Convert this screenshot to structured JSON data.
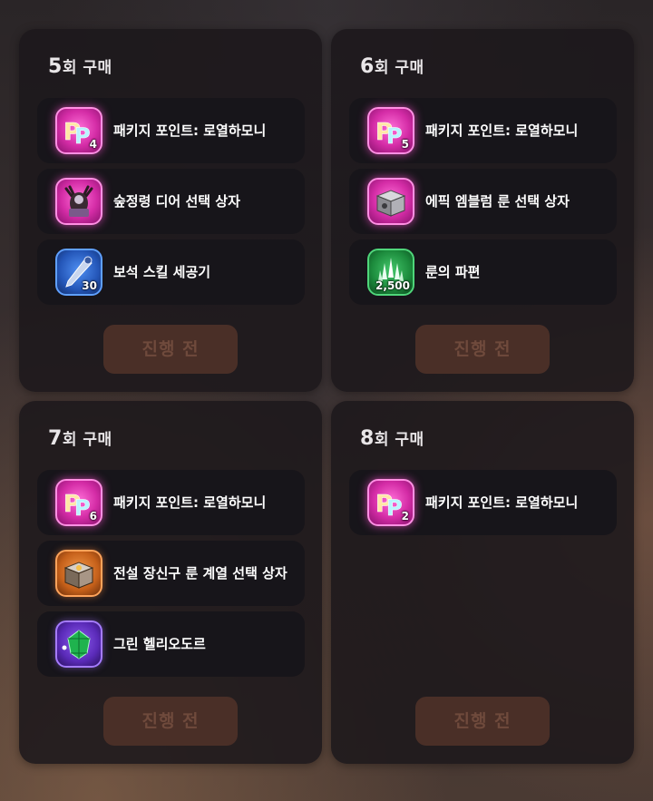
{
  "panels": [
    {
      "title_num": "5",
      "title_rest": "회 구매",
      "items": [
        {
          "label": "패키지 포인트: 로열하모니",
          "icon": "package-point-royal-harmony-icon",
          "count": "4"
        },
        {
          "label": "숲정령 디어 선택 상자",
          "icon": "forest-spirit-deer-box-icon",
          "count": ""
        },
        {
          "label": "보석 스킬 세공기",
          "icon": "gem-skill-crafter-icon",
          "count": "30"
        }
      ],
      "button": "진행 전"
    },
    {
      "title_num": "6",
      "title_rest": "회 구매",
      "items": [
        {
          "label": "패키지 포인트: 로열하모니",
          "icon": "package-point-royal-harmony-icon",
          "count": "5"
        },
        {
          "label": "에픽 엠블럼 룬 선택 상자",
          "icon": "epic-emblem-rune-box-icon",
          "count": ""
        },
        {
          "label": "룬의 파편",
          "icon": "rune-shard-icon",
          "count": "2,500"
        }
      ],
      "button": "진행 전"
    },
    {
      "title_num": "7",
      "title_rest": "회 구매",
      "items": [
        {
          "label": "패키지 포인트: 로열하모니",
          "icon": "package-point-royal-harmony-icon",
          "count": "6"
        },
        {
          "label": "전설 장신구 룬 계열 선택 상자",
          "icon": "legendary-accessory-rune-box-icon",
          "count": ""
        },
        {
          "label": "그린 헬리오도르",
          "icon": "green-heliodor-icon",
          "count": ""
        }
      ],
      "button": "진행 전"
    },
    {
      "title_num": "8",
      "title_rest": "회 구매",
      "items": [
        {
          "label": "패키지 포인트: 로열하모니",
          "icon": "package-point-royal-harmony-icon",
          "count": "2"
        }
      ],
      "button": "진행 전"
    }
  ]
}
